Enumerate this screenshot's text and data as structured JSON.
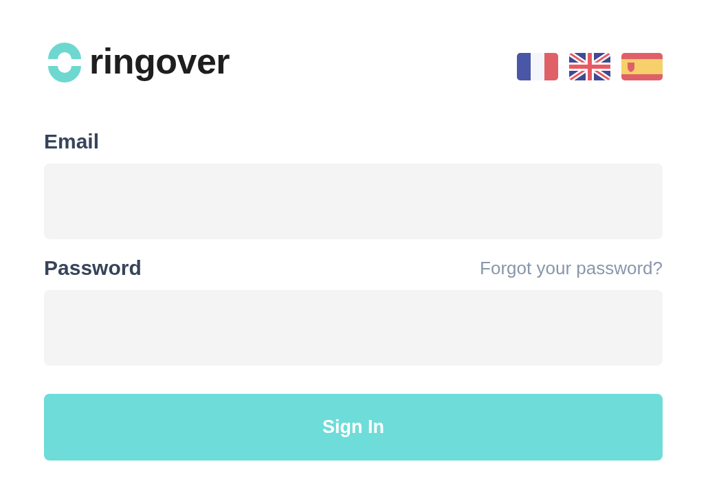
{
  "logo": {
    "text": "ringover"
  },
  "languages": [
    {
      "kind": "fr"
    },
    {
      "kind": "uk"
    },
    {
      "kind": "es"
    }
  ],
  "email": {
    "label": "Email"
  },
  "password": {
    "label": "Password",
    "forgot_link": "Forgot your password?"
  },
  "submit": {
    "label": "Sign In"
  }
}
